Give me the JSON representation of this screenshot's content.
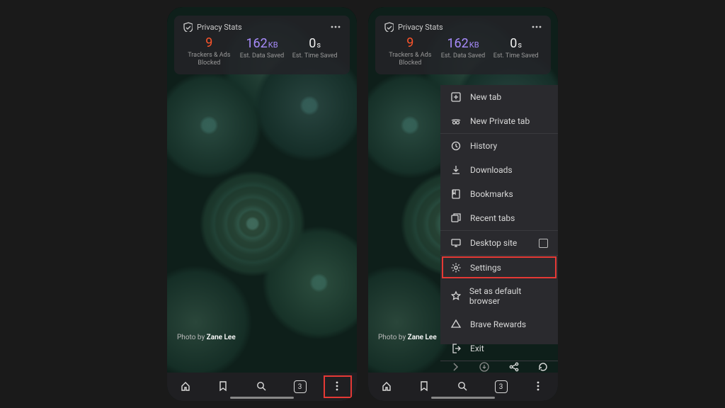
{
  "privacy": {
    "title": "Privacy Stats",
    "trackers": {
      "value": "9",
      "label": "Trackers & Ads Blocked",
      "color": "val-orange"
    },
    "data": {
      "value": "162",
      "unit": "KB",
      "label": "Est. Data Saved",
      "color": "val-purple"
    },
    "time": {
      "value": "0",
      "unit": "s",
      "label": "Est. Time Saved",
      "color": "val-white"
    }
  },
  "credit": {
    "prefix": "Photo by ",
    "author": "Zane Lee"
  },
  "nav": {
    "tab_count": "3"
  },
  "menu": {
    "items": [
      {
        "id": "new-tab",
        "label": "New tab"
      },
      {
        "id": "new-private",
        "label": "New Private tab"
      },
      {
        "id": "history",
        "label": "History",
        "sep": true
      },
      {
        "id": "downloads",
        "label": "Downloads"
      },
      {
        "id": "bookmarks",
        "label": "Bookmarks"
      },
      {
        "id": "recent-tabs",
        "label": "Recent tabs"
      },
      {
        "id": "desktop-site",
        "label": "Desktop site",
        "sep": true,
        "checkbox": true
      },
      {
        "id": "settings",
        "label": "Settings",
        "sep": true,
        "highlight": true
      },
      {
        "id": "set-default",
        "label": "Set as default browser"
      },
      {
        "id": "brave-rewards",
        "label": "Brave Rewards"
      },
      {
        "id": "exit",
        "label": "Exit"
      }
    ]
  }
}
